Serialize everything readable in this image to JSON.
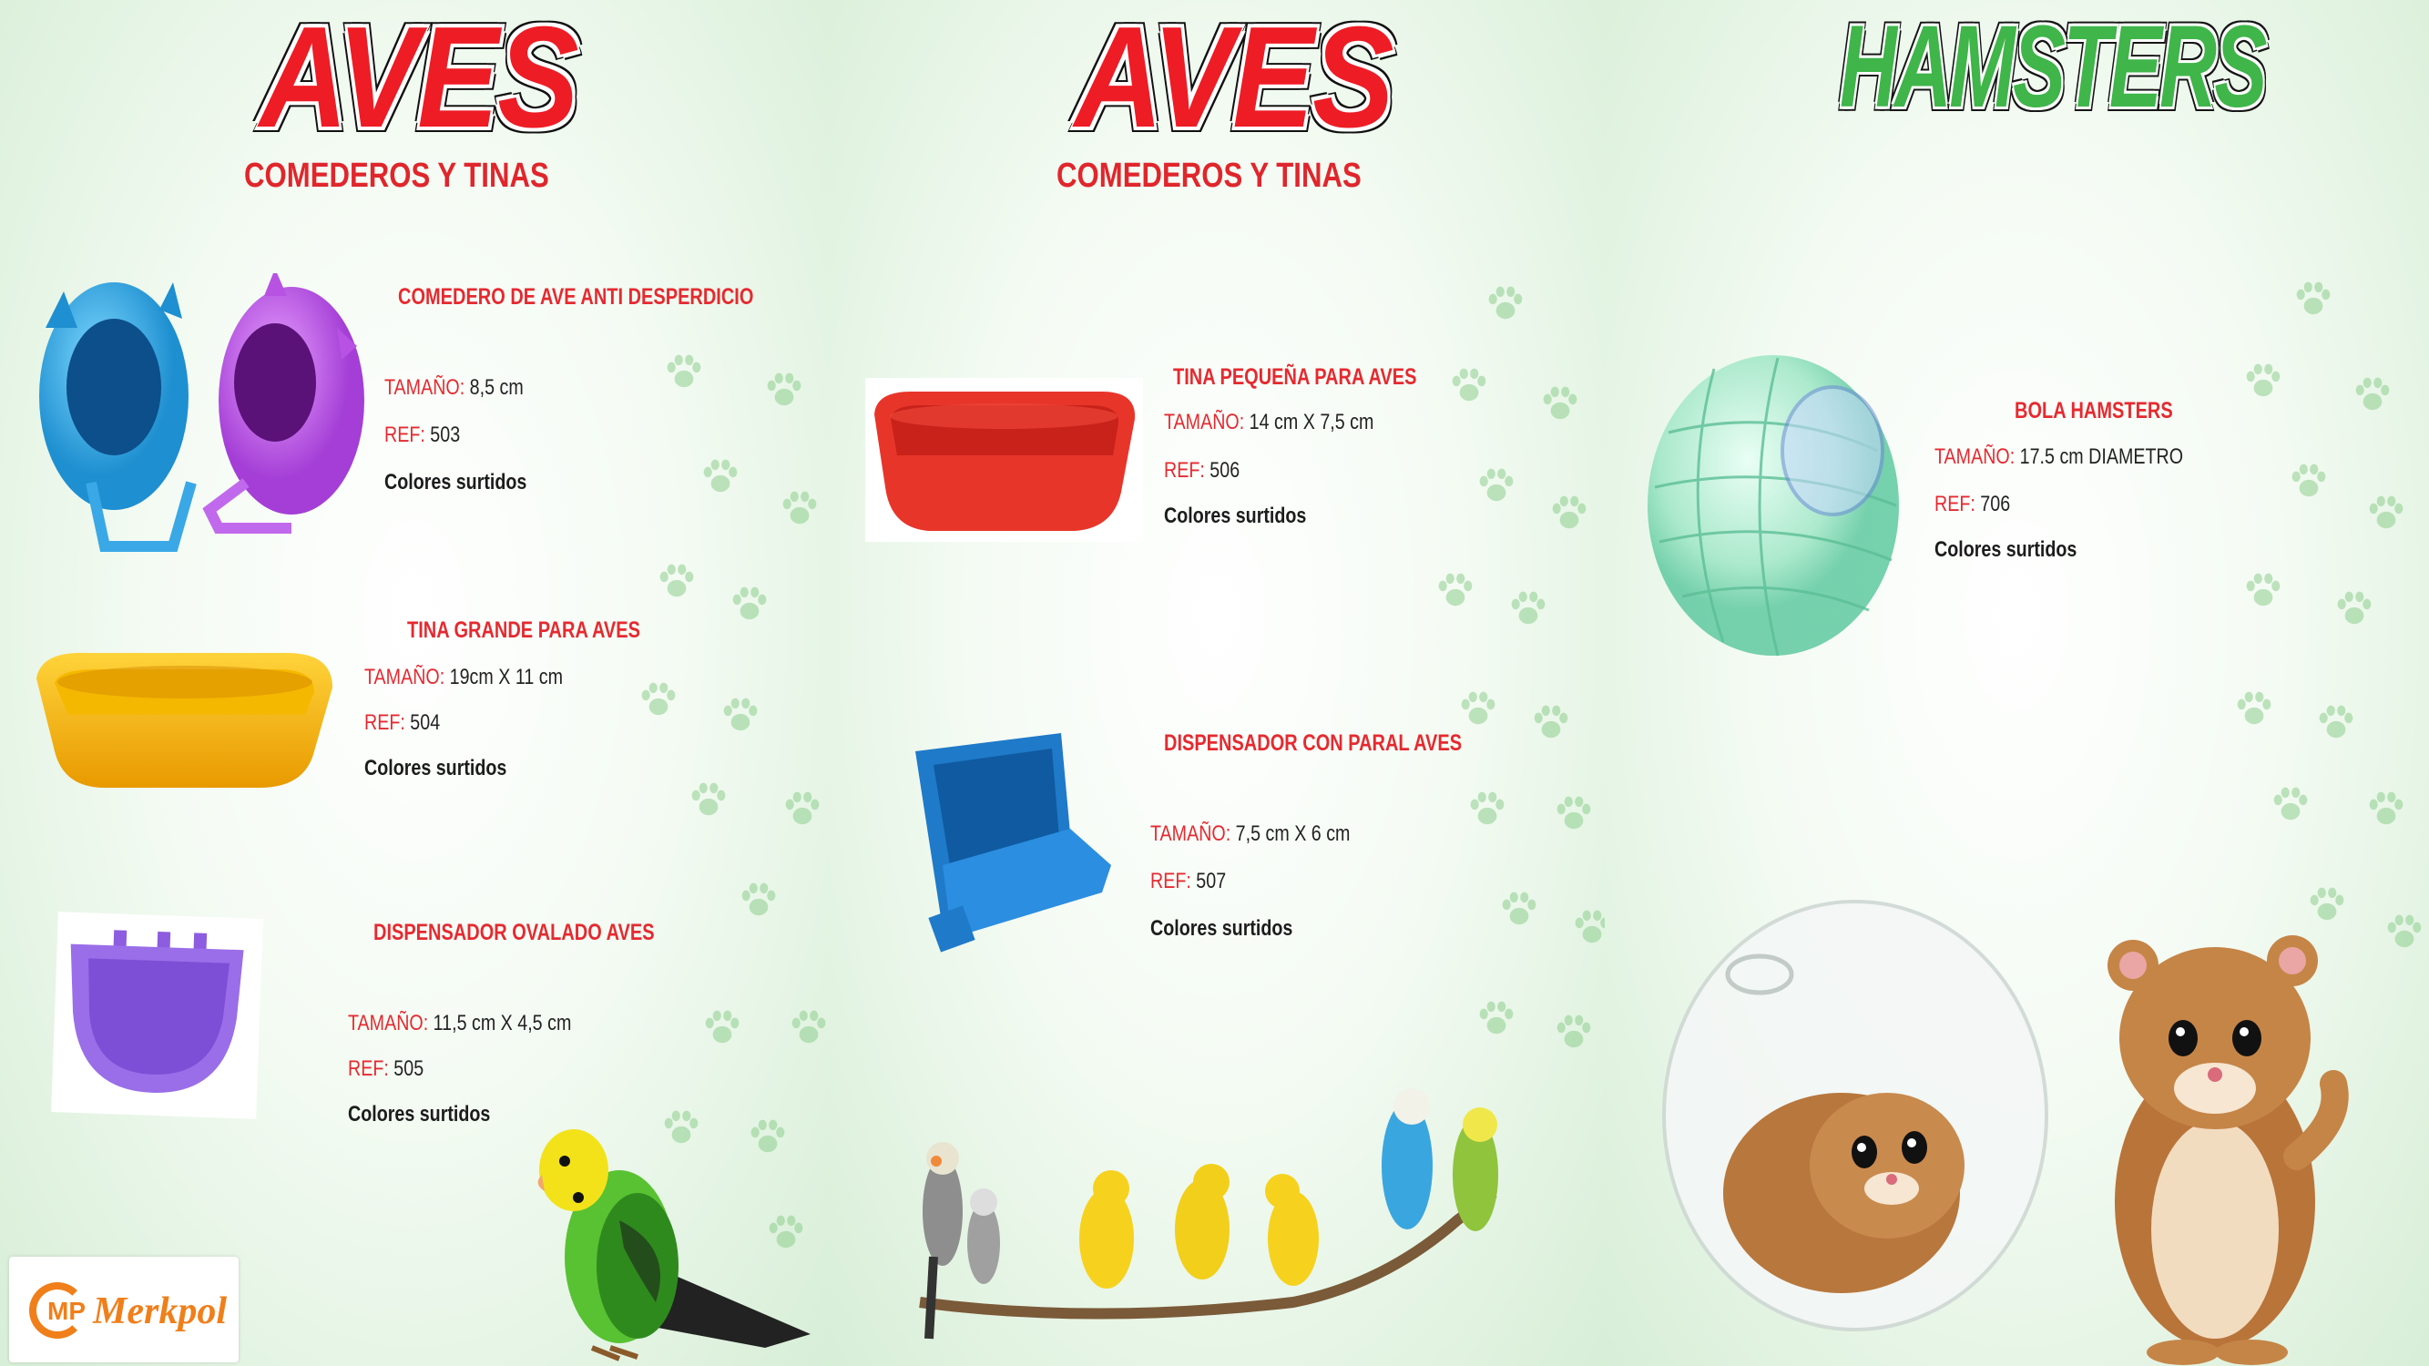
{
  "panel1": {
    "title": "AVES",
    "subtitle": "COMEDEROS Y TINAS",
    "products": [
      {
        "name": "COMEDERO DE AVE ANTI DESPERDICIO",
        "size_label": "TAMAÑO:",
        "size": " 8,5 cm",
        "ref_label": "REF:",
        "ref": " 503",
        "colors": "Colores surtidos"
      },
      {
        "name": "TINA GRANDE PARA AVES",
        "size_label": "TAMAÑO:",
        "size": " 19cm  X 11 cm",
        "ref_label": "REF:",
        "ref": " 504",
        "colors": "Colores surtidos"
      },
      {
        "name": "DISPENSADOR OVALADO AVES",
        "size_label": "TAMAÑO:",
        "size": "  11,5 cm X  4,5 cm",
        "ref_label": "REF:",
        "ref": " 505",
        "colors": "Colores surtidos"
      }
    ]
  },
  "panel2": {
    "title": "AVES",
    "subtitle": "COMEDEROS Y TINAS",
    "products": [
      {
        "name": "TINA  PEQUEÑA PARA AVES",
        "size_label": "TAMAÑO:",
        "size": "  14 cm X  7,5 cm",
        "ref_label": "REF:",
        "ref": " 506",
        "colors": "Colores surtidos"
      },
      {
        "name": "DISPENSADOR CON PARAL AVES",
        "size_label": "TAMAÑO:",
        "size": " 7,5 cm  X 6 cm",
        "ref_label": "REF:",
        "ref": " 507",
        "colors": "Colores surtidos"
      }
    ]
  },
  "panel3": {
    "title": "HAMSTERS",
    "products": [
      {
        "name": "BOLA HAMSTERS",
        "size_label": "TAMAÑO:",
        "size": " 17.5 cm  DIAMETRO",
        "ref_label": "REF:",
        "ref": " 706",
        "colors": "Colores surtidos"
      }
    ]
  },
  "logo": {
    "mark": "MP",
    "text": "Merkpol"
  },
  "colors": {
    "accent_red": "#e52a30",
    "hamster_green": "#3fb54a",
    "logo_orange": "#f07f1a"
  },
  "icons": [
    "paw-print-icon"
  ]
}
